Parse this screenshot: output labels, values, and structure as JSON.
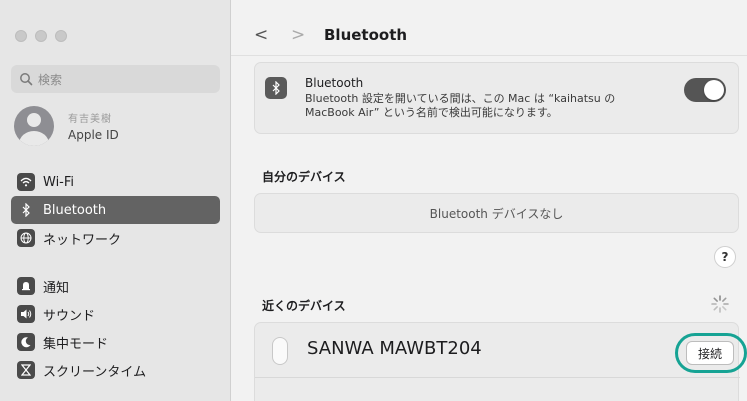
{
  "sidebar": {
    "search_placeholder": "検索",
    "account": {
      "name": "有吉美樹",
      "subtitle": "Apple ID"
    },
    "items": [
      {
        "label": "Wi-Fi",
        "icon": "wifi-icon"
      },
      {
        "label": "Bluetooth",
        "icon": "bluetooth-icon",
        "active": true
      },
      {
        "label": "ネットワーク",
        "icon": "globe-icon"
      },
      {
        "label": "通知",
        "icon": "bell-icon"
      },
      {
        "label": "サウンド",
        "icon": "speaker-icon"
      },
      {
        "label": "集中モード",
        "icon": "moon-icon"
      },
      {
        "label": "スクリーンタイム",
        "icon": "hourglass-icon"
      }
    ]
  },
  "header": {
    "title": "Bluetooth",
    "back_glyph": "<",
    "forward_glyph": ">"
  },
  "bluetooth_card": {
    "title": "Bluetooth",
    "description": "Bluetooth 設定を開いている間は、この Mac は “kaihatsu の MacBook Air” という名前で検出可能になります。",
    "enabled": true
  },
  "my_devices": {
    "title": "自分のデバイス",
    "empty_text": "Bluetooth デバイスなし"
  },
  "help_label": "?",
  "nearby": {
    "title": "近くのデバイス",
    "devices": [
      {
        "name": "SANWA MAWBT204",
        "button_label": "接続"
      }
    ]
  },
  "colors": {
    "highlight": "#16a394",
    "active_item": "#636363"
  }
}
